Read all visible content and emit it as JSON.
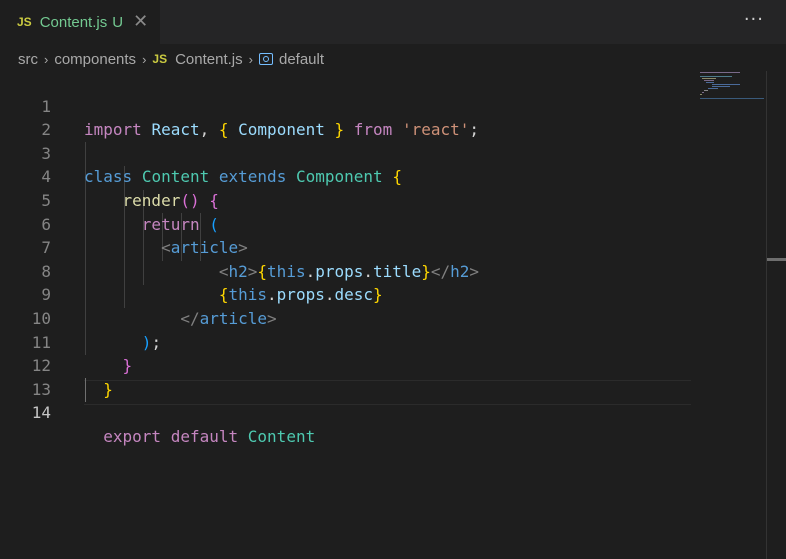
{
  "tab": {
    "badge": "JS",
    "name": "Content.js",
    "status": "U",
    "close": "✕"
  },
  "more_actions": "···",
  "breadcrumb": {
    "items": [
      "src",
      "components",
      "Content.js",
      "default"
    ],
    "file_badge": "JS",
    "separator": "›"
  },
  "editor": {
    "active_line": 14,
    "line_numbers": [
      "1",
      "2",
      "3",
      "4",
      "5",
      "6",
      "7",
      "8",
      "9",
      "10",
      "11",
      "12",
      "13",
      "14"
    ],
    "lines": [
      "import React, { Component } from 'react';",
      "",
      "class Content extends Component {",
      "    render() {",
      "      return (",
      "        <article>",
      "              <h2>{this.props.title}</h2>",
      "              {this.props.desc}",
      "          </article>",
      "      );",
      "    }",
      "  }",
      "",
      "  export default Content"
    ]
  },
  "colors": {
    "background": "#1e1e1e",
    "tab_text_untracked": "#73c991",
    "js_badge": "#cbcb41",
    "keyword_control": "#c586c0",
    "keyword": "#569cd6",
    "class_name": "#4ec9b0",
    "variable": "#9cdcfe",
    "function": "#dcdcaa",
    "string": "#ce9178"
  }
}
